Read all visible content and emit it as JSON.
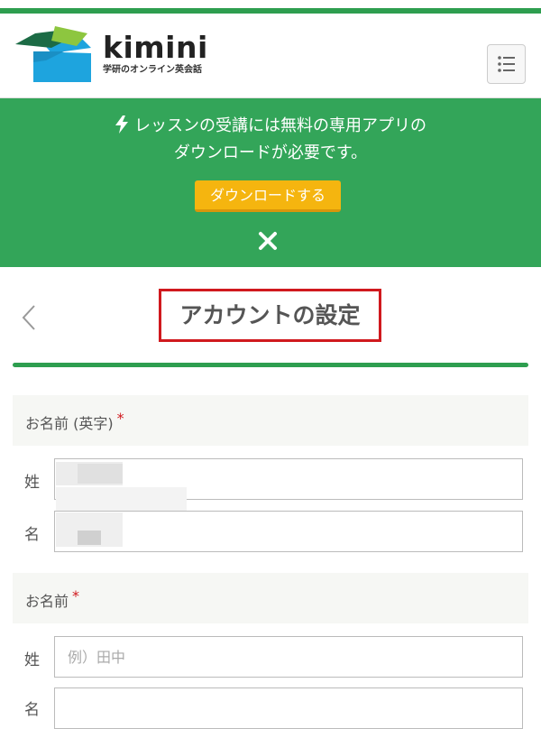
{
  "brand": {
    "name": "kimini",
    "tagline": "学研のオンライン英会話",
    "colors": {
      "green": "#2e9e4f",
      "darkGreen": "#1c6b45",
      "blue": "#1ea4de",
      "lime": "#8dc63f"
    }
  },
  "header": {
    "menu_icon": "list-menu-icon"
  },
  "banner": {
    "line1": "レッスンの受講には無料の専用アプリの",
    "line2": "ダウンロードが必要です。",
    "download_button": "ダウンロードする",
    "icon": "lightning-bolt-icon",
    "close_icon": "close-icon",
    "bg_color": "#33a559",
    "button_color": "#f5b50f"
  },
  "page": {
    "title": "アカウントの設定",
    "back_icon": "chevron-left-icon"
  },
  "form": {
    "section_english_name": {
      "label": "お名前 (英字)",
      "required_mark": "*",
      "last_name_label": "姓",
      "first_name_label": "名",
      "last_name_value": "",
      "first_name_value": ""
    },
    "section_name": {
      "label": "お名前",
      "required_mark": "*",
      "last_name_label": "姓",
      "last_name_placeholder": "例）田中",
      "first_name_label": "名"
    }
  }
}
